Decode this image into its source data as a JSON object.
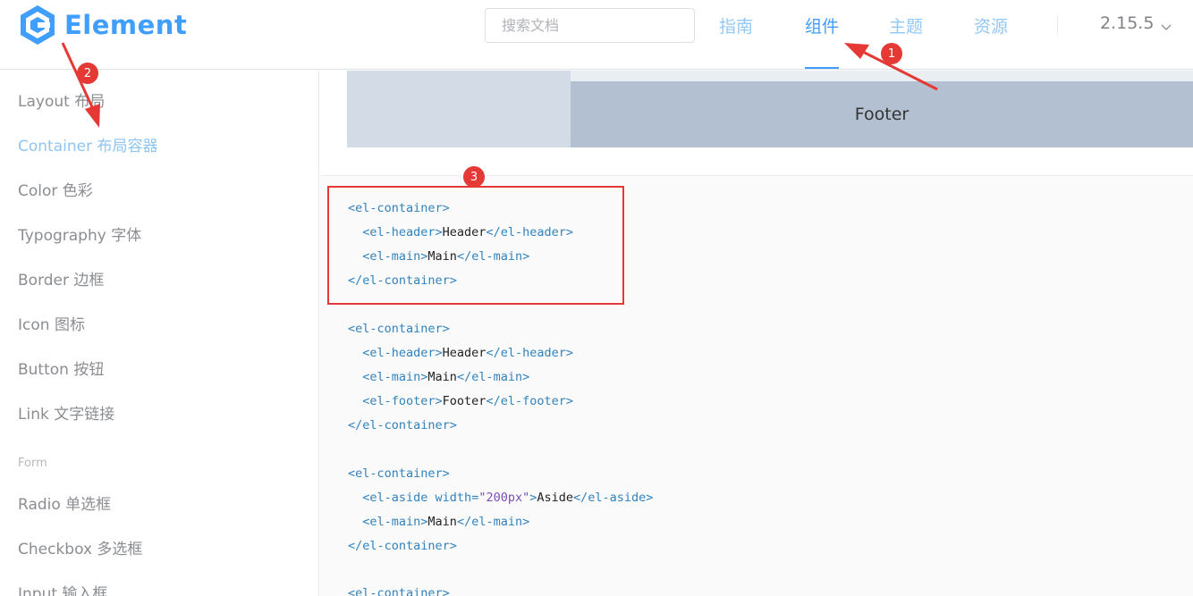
{
  "header": {
    "logo_text": "Element",
    "search_placeholder": "搜索文档",
    "nav": [
      {
        "label": "指南",
        "active": false
      },
      {
        "label": "组件",
        "active": true
      },
      {
        "label": "主题",
        "active": false
      },
      {
        "label": "资源",
        "active": false
      }
    ],
    "version": "2.15.5"
  },
  "sidebar": {
    "items": [
      {
        "label": "Layout 布局"
      },
      {
        "label": "Container 布局容器",
        "active": true
      },
      {
        "label": "Color 色彩"
      },
      {
        "label": "Typography 字体"
      },
      {
        "label": "Border 边框"
      },
      {
        "label": "Icon 图标"
      },
      {
        "label": "Button 按钮"
      },
      {
        "label": "Link 文字链接"
      }
    ],
    "group_form": "Form",
    "form_items": [
      {
        "label": "Radio 单选框"
      },
      {
        "label": "Checkbox 多选框"
      },
      {
        "label": "Input 输入框"
      }
    ]
  },
  "demo": {
    "footer_label": "Footer"
  },
  "code": {
    "block1": {
      "l1": "<el-container>",
      "l2_open": "<el-header>",
      "l2_text": "Header",
      "l2_close": "</el-header>",
      "l3_open": "<el-main>",
      "l3_text": "Main",
      "l3_close": "</el-main>",
      "l4": "</el-container>"
    },
    "block2": {
      "l1": "<el-container>",
      "l2_open": "<el-header>",
      "l2_text": "Header",
      "l2_close": "</el-header>",
      "l3_open": "<el-main>",
      "l3_text": "Main",
      "l3_close": "</el-main>",
      "l4_open": "<el-footer>",
      "l4_text": "Footer",
      "l4_close": "</el-footer>",
      "l5": "</el-container>"
    },
    "block3": {
      "l1": "<el-container>",
      "l2_tag": "<el-aside",
      "l2_attr": " width=",
      "l2_val": "\"200px\"",
      "l2_gt": ">",
      "l2_text": "Aside",
      "l2_close": "</el-aside>",
      "l3_open": "<el-main>",
      "l3_text": "Main",
      "l3_close": "</el-main>",
      "l4": "</el-container>"
    },
    "block4": {
      "l1": "<el-container>"
    }
  },
  "annotations": {
    "badge_1": "1",
    "badge_2": "2",
    "badge_3": "3",
    "color": "#e53935"
  },
  "colors": {
    "brand": "#409eff",
    "nav_inactive": "#92c8f6",
    "demo_aside": "#d3dce6",
    "demo_footer": "#b3c0d1"
  }
}
